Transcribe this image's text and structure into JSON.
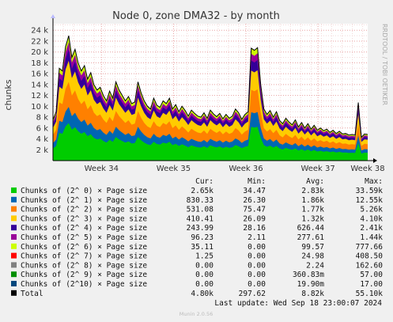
{
  "chart_data": {
    "type": "area",
    "title": "Node 0, zone DMA32 - by month",
    "ylabel": "chunks",
    "watermark": "RRDTOOL / TOBI OETIKER",
    "y_ticks": [
      2000,
      4000,
      6000,
      8000,
      10000,
      12000,
      14000,
      16000,
      18000,
      20000,
      22000,
      24000
    ],
    "y_tick_labels": [
      "2 k",
      "4 k",
      "6 k",
      "8 k",
      "10 k",
      "12 k",
      "14 k",
      "16 k",
      "18 k",
      "20 k",
      "22 k",
      "24 k"
    ],
    "ylim": [
      0,
      25200
    ],
    "x_ticks": [
      {
        "label": "Week 34",
        "x": 0.154
      },
      {
        "label": "Week 35",
        "x": 0.383
      },
      {
        "label": "Week 36",
        "x": 0.613
      },
      {
        "label": "Week 37",
        "x": 0.842
      }
    ],
    "x_ticks_extra": [
      {
        "label": "Week 38",
        "x": 1.0
      }
    ],
    "xlim": [
      0,
      1
    ],
    "grid": true,
    "columns": [
      "Cur:",
      "Min:",
      "Avg:",
      "Max:"
    ],
    "series": [
      {
        "name": "Chunks of (2^ 0) × Page size",
        "color": "#00cc00",
        "cur": "2.65k",
        "min": "34.47",
        "avg": "2.83k",
        "max": "33.59k"
      },
      {
        "name": "Chunks of (2^ 1) × Page size",
        "color": "#0066b3",
        "cur": "830.33",
        "min": "26.30",
        "avg": "1.86k",
        "max": "12.55k"
      },
      {
        "name": "Chunks of (2^ 2) × Page size",
        "color": "#ff8000",
        "cur": "531.08",
        "min": "75.47",
        "avg": "1.77k",
        "max": "5.26k"
      },
      {
        "name": "Chunks of (2^ 3) × Page size",
        "color": "#ffcc00",
        "cur": "410.41",
        "min": "26.09",
        "avg": "1.32k",
        "max": "4.10k"
      },
      {
        "name": "Chunks of (2^ 4) × Page size",
        "color": "#330099",
        "cur": "243.99",
        "min": "28.16",
        "avg": "626.44",
        "max": "2.41k"
      },
      {
        "name": "Chunks of (2^ 5) × Page size",
        "color": "#990099",
        "cur": "96.23",
        "min": "2.11",
        "avg": "277.61",
        "max": "1.44k"
      },
      {
        "name": "Chunks of (2^ 6) × Page size",
        "color": "#ccff00",
        "cur": "35.11",
        "min": "0.00",
        "avg": "99.57",
        "max": "777.66"
      },
      {
        "name": "Chunks of (2^ 7) × Page size",
        "color": "#ff0000",
        "cur": "1.25",
        "min": "0.00",
        "avg": "24.98",
        "max": "408.50"
      },
      {
        "name": "Chunks of (2^ 8) × Page size",
        "color": "#808080",
        "cur": "0.00",
        "min": "0.00",
        "avg": "2.24",
        "max": "162.60"
      },
      {
        "name": "Chunks of (2^ 9) × Page size",
        "color": "#008f00",
        "cur": "0.00",
        "min": "0.00",
        "avg": "360.83m",
        "max": "57.00"
      },
      {
        "name": "Chunks of (2^10) × Page size",
        "color": "#00487d",
        "cur": "0.00",
        "min": "0.00",
        "avg": "19.90m",
        "max": "17.00"
      },
      {
        "name": "Total",
        "color": "#000000",
        "cur": "4.80k",
        "min": "297.62",
        "avg": "8.82k",
        "max": "55.10k"
      }
    ],
    "total_curve": [
      [
        0.0,
        7500
      ],
      [
        0.01,
        9000
      ],
      [
        0.02,
        17000
      ],
      [
        0.03,
        16500
      ],
      [
        0.04,
        21000
      ],
      [
        0.05,
        23000
      ],
      [
        0.06,
        19000
      ],
      [
        0.07,
        20500
      ],
      [
        0.08,
        18000
      ],
      [
        0.09,
        16500
      ],
      [
        0.1,
        17500
      ],
      [
        0.11,
        15000
      ],
      [
        0.12,
        16200
      ],
      [
        0.13,
        14000
      ],
      [
        0.14,
        13000
      ],
      [
        0.15,
        13500
      ],
      [
        0.16,
        12000
      ],
      [
        0.17,
        11000
      ],
      [
        0.18,
        12800
      ],
      [
        0.19,
        11500
      ],
      [
        0.2,
        14500
      ],
      [
        0.21,
        13000
      ],
      [
        0.22,
        12000
      ],
      [
        0.23,
        11000
      ],
      [
        0.24,
        11800
      ],
      [
        0.25,
        10500
      ],
      [
        0.26,
        10800
      ],
      [
        0.27,
        14500
      ],
      [
        0.28,
        12500
      ],
      [
        0.29,
        11000
      ],
      [
        0.3,
        10000
      ],
      [
        0.31,
        9500
      ],
      [
        0.32,
        11500
      ],
      [
        0.33,
        10200
      ],
      [
        0.34,
        9800
      ],
      [
        0.35,
        11000
      ],
      [
        0.36,
        10500
      ],
      [
        0.37,
        11500
      ],
      [
        0.38,
        9500
      ],
      [
        0.39,
        10300
      ],
      [
        0.4,
        9000
      ],
      [
        0.41,
        10000
      ],
      [
        0.42,
        9200
      ],
      [
        0.43,
        8200
      ],
      [
        0.44,
        9300
      ],
      [
        0.45,
        8700
      ],
      [
        0.46,
        8200
      ],
      [
        0.47,
        8000
      ],
      [
        0.48,
        8800
      ],
      [
        0.49,
        7800
      ],
      [
        0.5,
        9300
      ],
      [
        0.51,
        8600
      ],
      [
        0.52,
        8100
      ],
      [
        0.53,
        8700
      ],
      [
        0.54,
        7700
      ],
      [
        0.55,
        8500
      ],
      [
        0.56,
        7800
      ],
      [
        0.57,
        8200
      ],
      [
        0.58,
        9500
      ],
      [
        0.59,
        8800
      ],
      [
        0.6,
        7600
      ],
      [
        0.61,
        8500
      ],
      [
        0.62,
        9000
      ],
      [
        0.63,
        20700
      ],
      [
        0.64,
        20300
      ],
      [
        0.65,
        20800
      ],
      [
        0.66,
        14000
      ],
      [
        0.67,
        9500
      ],
      [
        0.68,
        8500
      ],
      [
        0.69,
        9200
      ],
      [
        0.7,
        8000
      ],
      [
        0.71,
        9000
      ],
      [
        0.72,
        7400
      ],
      [
        0.73,
        6800
      ],
      [
        0.74,
        7800
      ],
      [
        0.75,
        7100
      ],
      [
        0.76,
        6600
      ],
      [
        0.77,
        7500
      ],
      [
        0.78,
        6200
      ],
      [
        0.79,
        7000
      ],
      [
        0.8,
        6000
      ],
      [
        0.81,
        6800
      ],
      [
        0.82,
        5800
      ],
      [
        0.83,
        6500
      ],
      [
        0.84,
        5600
      ],
      [
        0.85,
        6000
      ],
      [
        0.86,
        5500
      ],
      [
        0.87,
        5800
      ],
      [
        0.88,
        5200
      ],
      [
        0.89,
        5600
      ],
      [
        0.9,
        5000
      ],
      [
        0.91,
        5400
      ],
      [
        0.92,
        4900
      ],
      [
        0.93,
        5000
      ],
      [
        0.94,
        4700
      ],
      [
        0.95,
        4800
      ],
      [
        0.96,
        4700
      ],
      [
        0.97,
        10700
      ],
      [
        0.98,
        4300
      ],
      [
        0.99,
        4900
      ],
      [
        1.0,
        4800
      ]
    ]
  },
  "footer": {
    "last_update": "Last update: Wed Sep 18 23:00:07 2024",
    "version": "Munin 2.0.56"
  }
}
